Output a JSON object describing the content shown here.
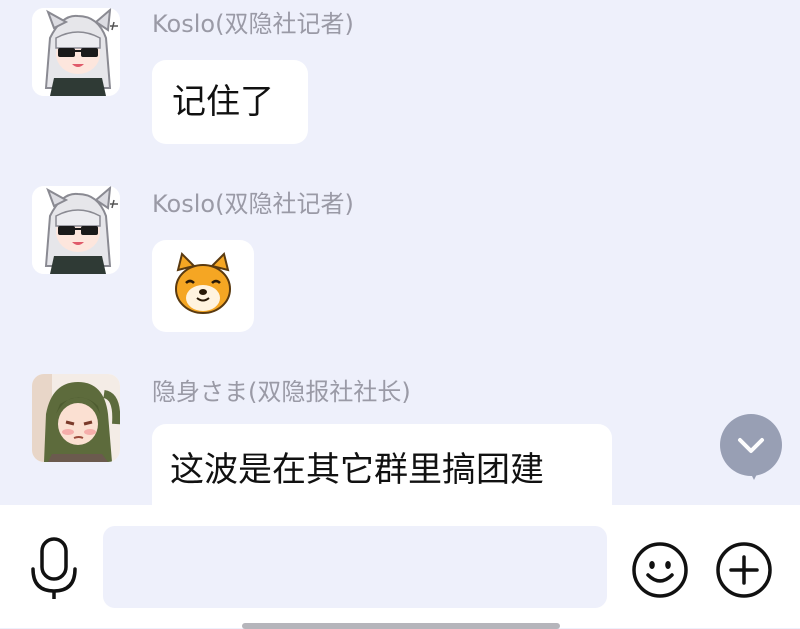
{
  "messages": [
    {
      "sender": "Koslo(双隐社记者)",
      "text": "记住了",
      "avatar": "white-haired-catgirl-sunglasses-avatar"
    },
    {
      "sender": "Koslo(双隐社记者)",
      "sticker": "shiba-dog-emoji",
      "avatar": "white-haired-catgirl-sunglasses-avatar"
    },
    {
      "sender": "隐身さま(双隐报社社长)",
      "text": "这波是在其它群里搞团建",
      "avatar": "green-haired-girl-avatar"
    }
  ],
  "input": {
    "placeholder": "",
    "value": ""
  },
  "icons": {
    "voice": "microphone-icon",
    "emoji": "smiley-icon",
    "more": "plus-circle-icon",
    "scroll": "chevron-down-icon"
  },
  "colors": {
    "background": "#eef0fb",
    "bubble": "#ffffff",
    "sender": "#9a9aa6",
    "scroll_button": "#8f97ad"
  }
}
